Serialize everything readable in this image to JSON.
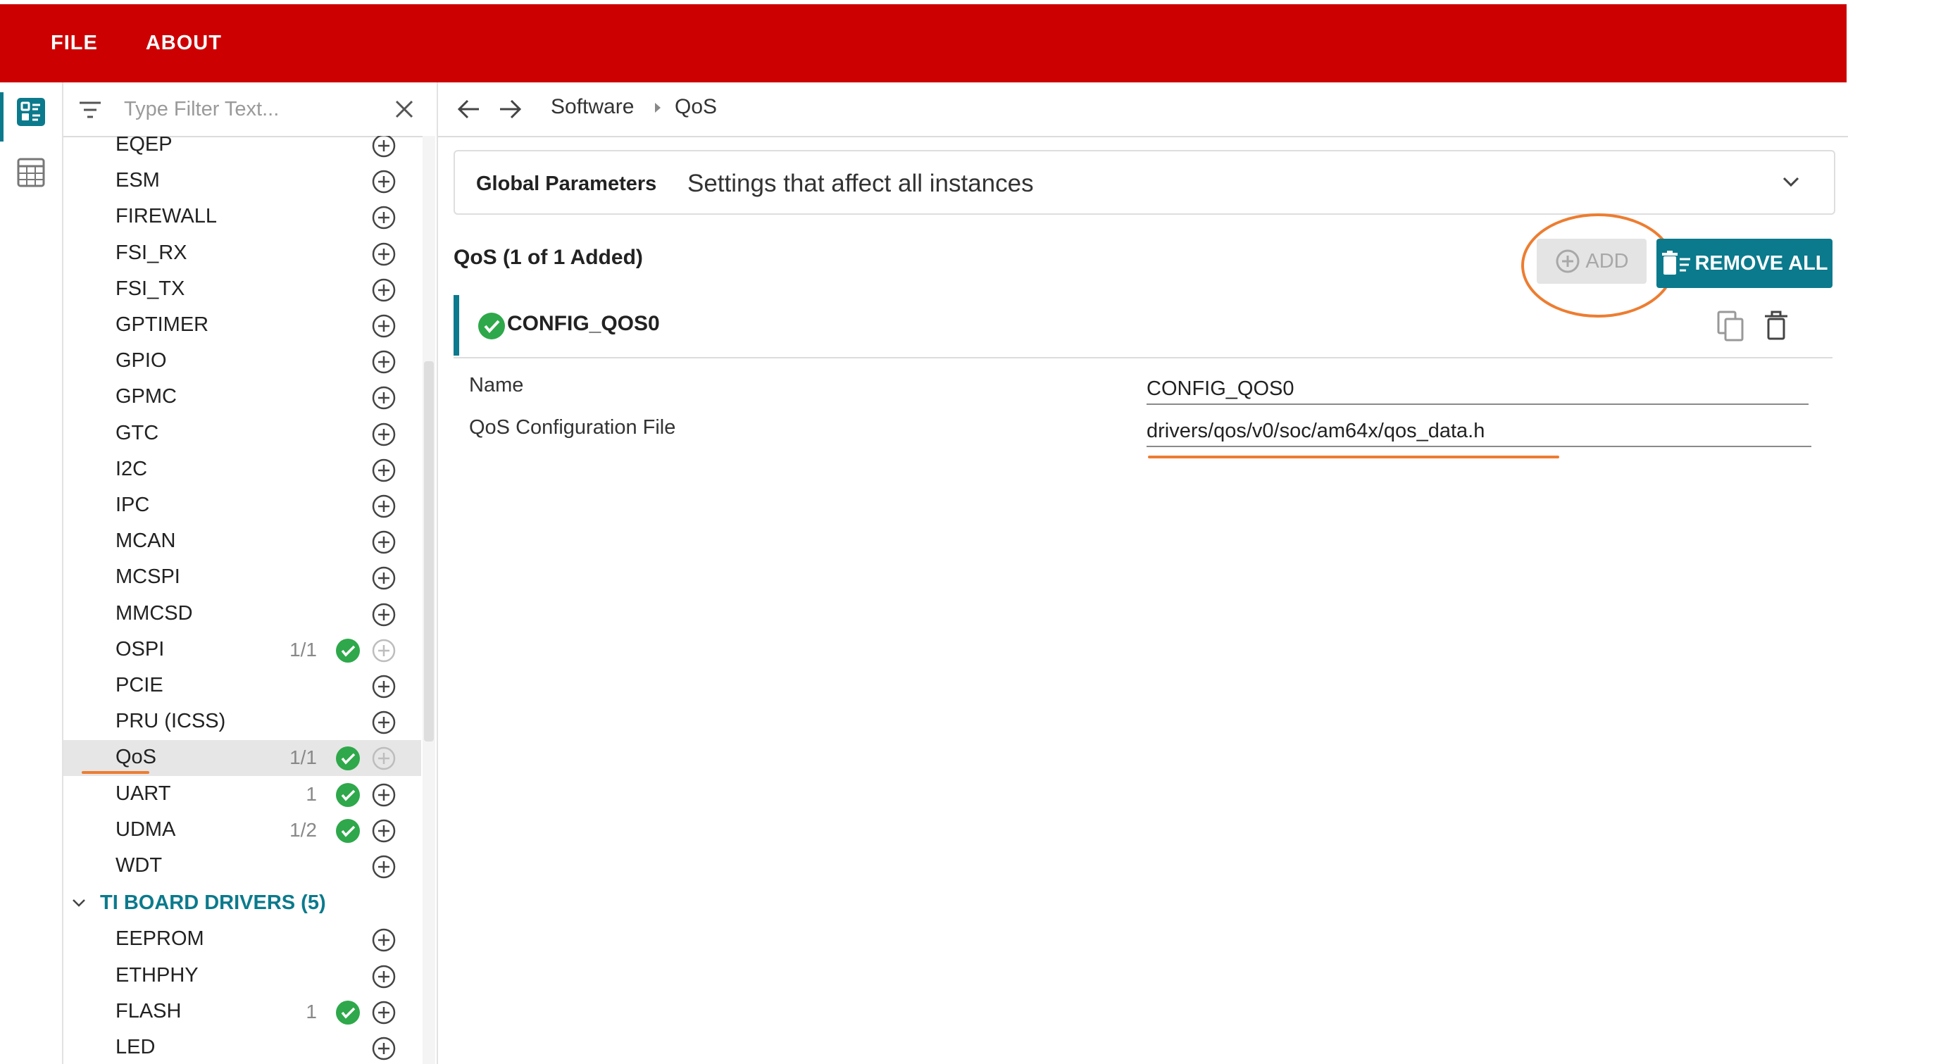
{
  "menu": {
    "items": [
      "FILE",
      "ABOUT"
    ]
  },
  "rail": {
    "icons": [
      "list-view-icon",
      "calculator-icon"
    ]
  },
  "filter": {
    "placeholder": "Type Filter Text..."
  },
  "tree": {
    "modules": [
      {
        "label": "EQEP",
        "count": "",
        "ok": false
      },
      {
        "label": "ESM",
        "count": "",
        "ok": false
      },
      {
        "label": "FIREWALL",
        "count": "",
        "ok": false
      },
      {
        "label": "FSI_RX",
        "count": "",
        "ok": false
      },
      {
        "label": "FSI_TX",
        "count": "",
        "ok": false
      },
      {
        "label": "GPTIMER",
        "count": "",
        "ok": false
      },
      {
        "label": "GPIO",
        "count": "",
        "ok": false
      },
      {
        "label": "GPMC",
        "count": "",
        "ok": false
      },
      {
        "label": "GTC",
        "count": "",
        "ok": false
      },
      {
        "label": "I2C",
        "count": "",
        "ok": false
      },
      {
        "label": "IPC",
        "count": "",
        "ok": false
      },
      {
        "label": "MCAN",
        "count": "",
        "ok": false
      },
      {
        "label": "MCSPI",
        "count": "",
        "ok": false
      },
      {
        "label": "MMCSD",
        "count": "",
        "ok": false
      },
      {
        "label": "OSPI",
        "count": "1/1",
        "ok": true
      },
      {
        "label": "PCIE",
        "count": "",
        "ok": false
      },
      {
        "label": "PRU (ICSS)",
        "count": "",
        "ok": false
      },
      {
        "label": "QoS",
        "count": "1/1",
        "ok": true
      },
      {
        "label": "UART",
        "count": "1",
        "ok": true
      },
      {
        "label": "UDMA",
        "count": "1/2",
        "ok": true
      },
      {
        "label": "WDT",
        "count": "",
        "ok": false
      }
    ],
    "group": {
      "label": "TI BOARD DRIVERS (5)"
    },
    "board_modules": [
      {
        "label": "EEPROM",
        "count": "",
        "ok": false
      },
      {
        "label": "ETHPHY",
        "count": "",
        "ok": false
      },
      {
        "label": "FLASH",
        "count": "1",
        "ok": true
      },
      {
        "label": "LED",
        "count": "",
        "ok": false
      }
    ]
  },
  "breadcrumb": {
    "items": [
      "Software",
      "QoS"
    ]
  },
  "global": {
    "title": "Global Parameters",
    "description": "Settings that affect all instances"
  },
  "module": {
    "heading": "QoS (1 of 1 Added)",
    "add_label": "ADD",
    "remove_all_label": "REMOVE ALL",
    "instance": {
      "name": "CONFIG_QOS0"
    },
    "properties": [
      {
        "label": "Name",
        "value": "CONFIG_QOS0"
      },
      {
        "label": "QoS Configuration File",
        "value": "drivers/qos/v0/soc/am64x/qos_data.h"
      }
    ]
  },
  "colors": {
    "brand_red": "#cc0000",
    "teal": "#0b7a8c",
    "ok_green": "#2ea84a",
    "highlight_orange": "#ed7d31"
  }
}
